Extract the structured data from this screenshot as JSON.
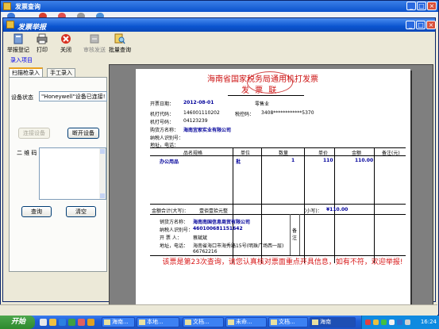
{
  "outer_window": {
    "title": "发票查询"
  },
  "inner_window": {
    "title": "发票举报"
  },
  "toolbar": {
    "items": [
      {
        "label": "举报登记",
        "icon": "report-register-icon",
        "enabled": true
      },
      {
        "label": "打印",
        "icon": "printer-icon",
        "enabled": true
      },
      {
        "label": "关闭",
        "icon": "close-icon",
        "enabled": true
      },
      {
        "label": "审核发送",
        "icon": "review-send-icon",
        "enabled": false
      },
      {
        "label": "批量查询",
        "icon": "batch-query-icon",
        "enabled": true
      }
    ]
  },
  "section_label": "录入项目",
  "left_panel": {
    "tabs": [
      "扫描枪录入",
      "手工录入"
    ],
    "device_status_label": "设备状态",
    "device_status_value": "\"Honeywell\"设备已连接!",
    "connect_button": "连接设备",
    "disconnect_button": "断开设备",
    "qrcode_label": "二 维 码",
    "query_button": "查询",
    "clear_button": "清空"
  },
  "invoice": {
    "title": "海南省国家税务局通用机打发票",
    "subtitle": "发 票 联",
    "date_label": "开票日期：",
    "date_value": "2012-08-01",
    "industry": "零售业",
    "code_label": "机打代码：",
    "code_value": "146001110202",
    "tax_control_label": "税控码：",
    "tax_control_value": "3408************5370",
    "number_label": "机打号码：",
    "number_value": "04123239",
    "payer_label": "购货方名称：",
    "payer_value": "海南宜家实业有限公司",
    "payer_id_label": "纳税人识别号：",
    "payer_addr_label": "地址，电话：",
    "columns": [
      "品名规格",
      "单位",
      "数量",
      "单价",
      "金额",
      "备注(元)"
    ],
    "rows": [
      {
        "name": "办公用品",
        "unit": "批",
        "qty": "1",
        "price": "110",
        "amount": "110.00"
      }
    ],
    "total_label": "金额合计(大写)：",
    "total_upper": "壹佰壹拾元整",
    "total_small_label": "(小写)：",
    "total_small": "¥110.00",
    "seller_name_label": "销货方名称：",
    "seller_name_value": "海南南国信息商贸有限公司",
    "seller_id_label": "纳税人识别号：",
    "seller_id_value": "460100681151642",
    "drawer_label": "开 票 人：",
    "drawer_value": "蔡斌斌",
    "seller_addr_label": "地址，电话：",
    "seller_addr_value": "海南省海口市海秀路15号(明珠广场西一层)",
    "seller_phone": "66762216",
    "remark_label": "备注",
    "notice": "该票是第23次查询，请您认真核对票面重点开具信息，如有不符，欢迎举报!"
  },
  "taskbar": {
    "start_label": "开始",
    "tasks": [
      "海南...",
      "本地...",
      "文档...",
      "未命...",
      "文档...",
      "海南"
    ],
    "clock": "16:24"
  }
}
